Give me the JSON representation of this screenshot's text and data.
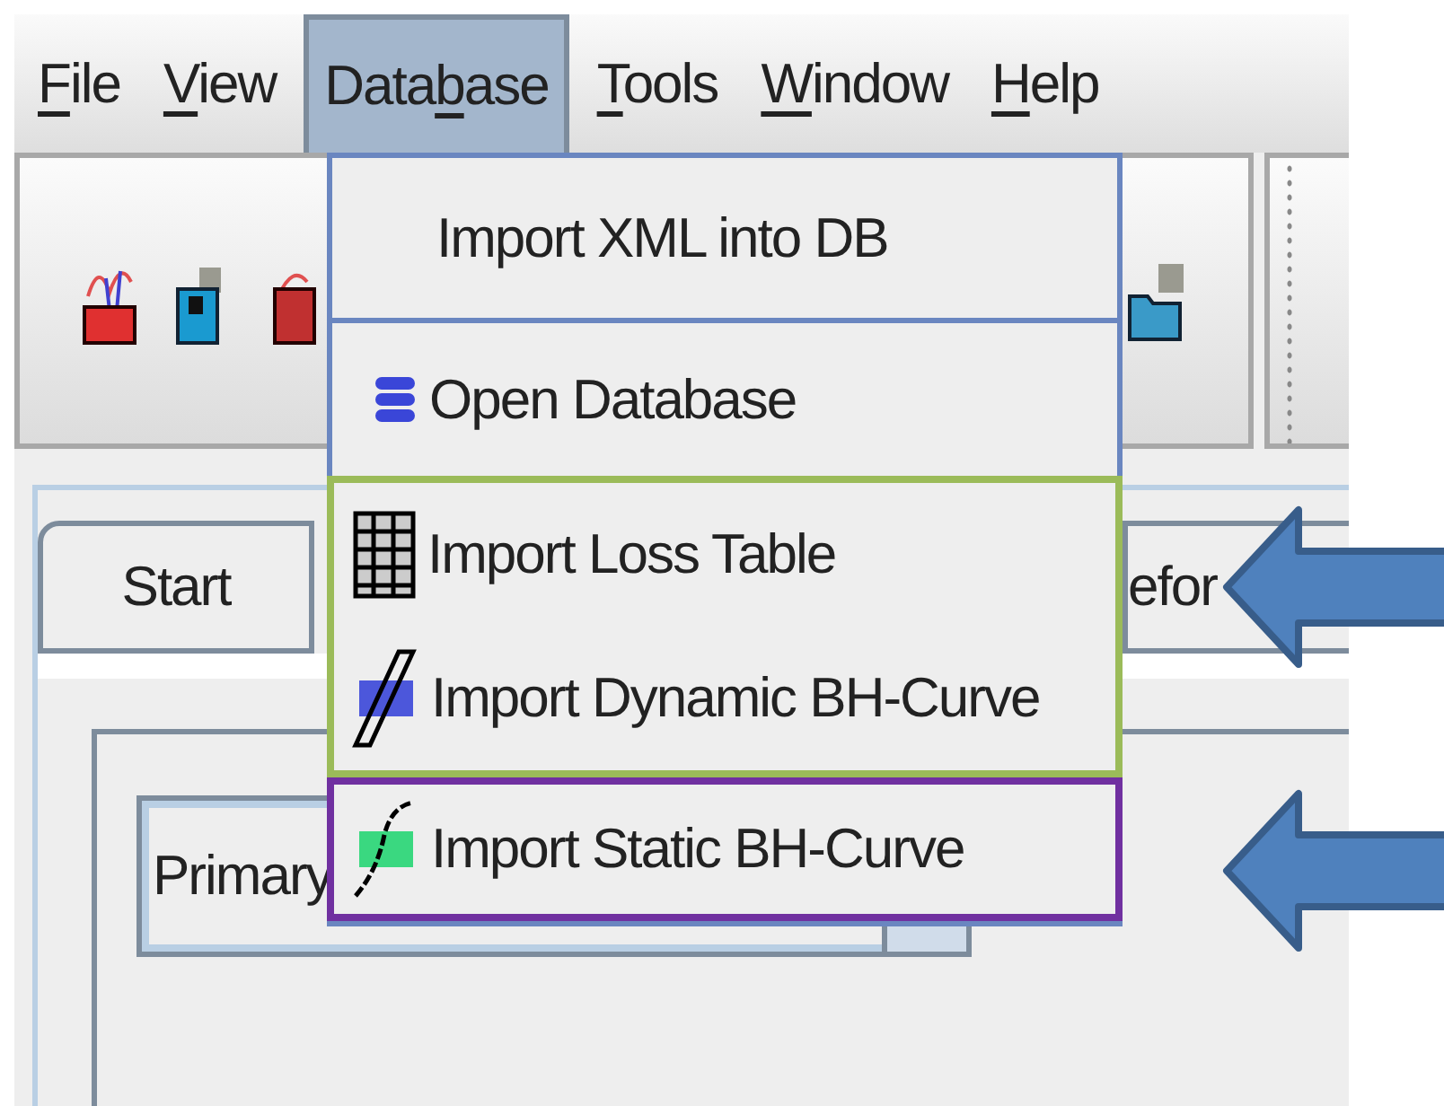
{
  "menubar": [
    {
      "key": "F",
      "post": "ile",
      "selected": false
    },
    {
      "key": "V",
      "post": "iew",
      "selected": false
    },
    {
      "pre": "Data",
      "key": "b",
      "post": "ase",
      "selected": true
    },
    {
      "key": "T",
      "post": "ools",
      "selected": false
    },
    {
      "key": "W",
      "post": "indow",
      "selected": false
    },
    {
      "key": "H",
      "post": "elp",
      "selected": false
    }
  ],
  "menu": {
    "groups": [
      {
        "items": [
          {
            "label": "Import XML into DB",
            "kind": "plain"
          }
        ]
      },
      {
        "items": [
          {
            "label": "Open Database",
            "kind": "database"
          }
        ]
      },
      {
        "color": "#9bbb59",
        "arrow": true,
        "items": [
          {
            "label": "Import Loss Table",
            "kind": "table"
          },
          {
            "label": "Import Dynamic BH-Curve",
            "kind": "bh-dynamic"
          }
        ]
      },
      {
        "color": "#7030a0",
        "arrow": true,
        "items": [
          {
            "label": "Import Static BH-Curve",
            "kind": "bh-static"
          }
        ]
      }
    ]
  },
  "tabs": [
    {
      "label": "Start"
    },
    {
      "label": "efor"
    }
  ],
  "combo": {
    "value": "Primary"
  }
}
